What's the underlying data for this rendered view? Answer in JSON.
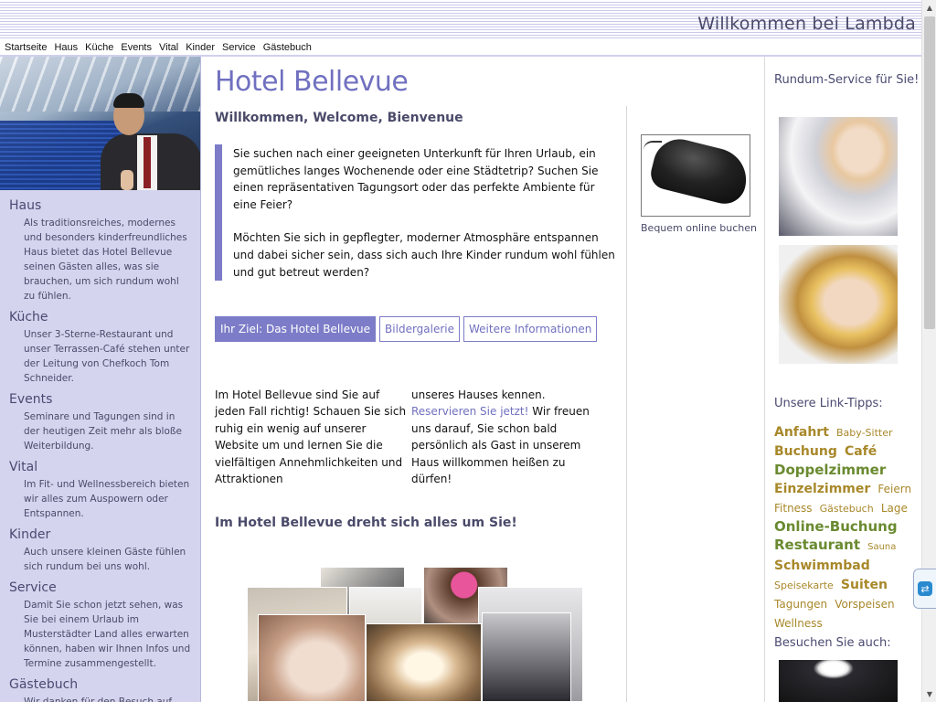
{
  "header": {
    "title": "Willkommen bei Lambda"
  },
  "nav": {
    "items": [
      "Startseite",
      "Haus",
      "Küche",
      "Events",
      "Vital",
      "Kinder",
      "Service",
      "Gästebuch"
    ]
  },
  "sidebar": {
    "sections": [
      {
        "title": "Haus",
        "text": "Als traditionsreiches, modernes und besonders kinderfreundliches Haus bietet das Hotel Bellevue seinen Gästen alles, was sie brauchen, um sich rundum wohl zu fühlen."
      },
      {
        "title": "Küche",
        "text": "Unser 3-Sterne-Restaurant und unser Terrassen-Café stehen unter der Leitung von Chefkoch Tom Schneider."
      },
      {
        "title": "Events",
        "text": "Seminare und Tagungen sind in der heutigen Zeit mehr als bloße Weiterbildung."
      },
      {
        "title": "Vital",
        "text": "Im Fit- und Wellnessbereich bieten wir alles zum Auspowern oder Entspannen."
      },
      {
        "title": "Kinder",
        "text": "Auch unsere kleinen Gäste fühlen sich rundum bei uns wohl."
      },
      {
        "title": "Service",
        "text": "Damit Sie schon jetzt sehen, was Sie bei einem Urlaub im Musterstädter Land alles erwarten können, haben wir Ihnen Infos und Termine zusammengestellt."
      },
      {
        "title": "Gästebuch",
        "text": "Wir danken für den Besuch auf"
      }
    ]
  },
  "main": {
    "title": "Hotel Bellevue",
    "welcome": "Willkommen, Welcome, Bienvenue",
    "intro_p1": "Sie suchen nach einer geeigneten Unterkunft für Ihren Urlaub, ein gemütliches langes Wochenende oder eine Städtetrip? Suchen Sie einen repräsentativen Tagungsort oder das perfekte Ambiente für eine Feier?",
    "intro_p2": "Möchten Sie sich in gepflegter, moderner Atmosphäre entspannen und dabei sicher sein, dass sich auch Ihre Kinder rundum wohl fühlen und gut betreut werden?",
    "image_caption": "Bequem online buchen",
    "tabs": [
      {
        "label": "Ihr Ziel: Das Hotel Bellevue",
        "active": true
      },
      {
        "label": "Bildergalerie",
        "active": false
      },
      {
        "label": "Weitere Informationen",
        "active": false
      }
    ],
    "col1": "Im Hotel Bellevue sind Sie auf jeden Fall richtig! Schauen Sie sich ruhig ein wenig auf unserer Website um und lernen Sie die vielfältigen Annehmlichkeiten und Attraktionen",
    "col2_before": "unseres Hauses kennen.",
    "col2_link": "Reservieren Sie jetzt!",
    "col2_after": "Wir freuen uns darauf, Sie schon bald persönlich als Gast in unserem Haus willkommen heißen zu dürfen!",
    "subheading": "Im Hotel Bellevue dreht sich alles um Sie!"
  },
  "right": {
    "service_heading": "Rundum-Service für Sie!",
    "links_heading": "Unsere Link-Tipps:",
    "tags": [
      {
        "label": "Anfahrt",
        "size": "l"
      },
      {
        "label": "Baby-Sitter",
        "size": "s"
      },
      {
        "label": "Buchung",
        "size": "l"
      },
      {
        "label": "Café",
        "size": "l"
      },
      {
        "label": "Doppelzimmer",
        "size": "xl"
      },
      {
        "label": "Einzelzimmer",
        "size": "l"
      },
      {
        "label": "Feiern",
        "size": "m"
      },
      {
        "label": "Fitness",
        "size": "m"
      },
      {
        "label": "Gästebuch",
        "size": "s"
      },
      {
        "label": "Lage",
        "size": "m"
      },
      {
        "label": "Online-Buchung",
        "size": "xl"
      },
      {
        "label": "Restaurant",
        "size": "xl"
      },
      {
        "label": "Sauna",
        "size": "xs"
      },
      {
        "label": "Schwimmbad",
        "size": "l"
      },
      {
        "label": "Speisekarte",
        "size": "s"
      },
      {
        "label": "Suiten",
        "size": "l"
      },
      {
        "label": "Tagungen",
        "size": "m"
      },
      {
        "label": "Vorspeisen",
        "size": "m"
      },
      {
        "label": "Wellness",
        "size": "m"
      }
    ],
    "visit_heading": "Besuchen Sie auch:"
  },
  "colors": {
    "accent": "#7c7cc8",
    "title": "#7070c0",
    "sidebar_bg": "#d4d4ee",
    "tag_color_a": "#a8882a",
    "tag_color_b": "#6a8a30"
  }
}
